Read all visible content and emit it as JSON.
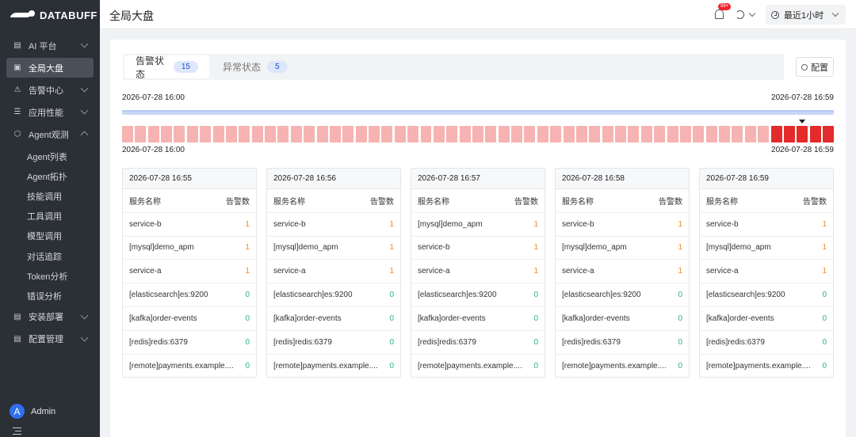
{
  "brand": {
    "name": "DATABUFF"
  },
  "sidebar": {
    "items": [
      {
        "label": "AI 平台",
        "icon": "chart-icon",
        "chevron": "down"
      },
      {
        "label": "全局大盘",
        "icon": "dashboard-icon",
        "active": true
      },
      {
        "label": "告警中心",
        "icon": "alert-icon",
        "chevron": "down"
      },
      {
        "label": "应用性能",
        "icon": "list-icon",
        "chevron": "down"
      },
      {
        "label": "Agent观测",
        "icon": "cube-icon",
        "chevron": "up"
      }
    ],
    "sub_items": [
      "Agent列表",
      "Agent拓扑",
      "技能调用",
      "工具调用",
      "模型调用",
      "对话追踪",
      "Token分析",
      "错误分析"
    ],
    "bottom_items": [
      {
        "label": "安装部署",
        "icon": "install-icon",
        "chevron": "down"
      },
      {
        "label": "配置管理",
        "icon": "settings-icon",
        "chevron": "down"
      }
    ],
    "user": {
      "initial": "A",
      "name": "Admin"
    }
  },
  "header": {
    "title": "全局大盘",
    "notification_badge": "99+",
    "time_range": "最近1小时"
  },
  "tabs": [
    {
      "label": "告警状态",
      "count": "15"
    },
    {
      "label": "异常状态",
      "count": "5"
    }
  ],
  "config_label": "配置",
  "timeline": {
    "range_start": "2026-07-28 16:00",
    "range_end": "2026-07-28 16:59",
    "blocks_start": "2026-07-28 16:00",
    "blocks_end": "2026-07-28 16:59",
    "block_count": 55,
    "severe_from_index": 50,
    "colors": {
      "normal": "#f6b3b1",
      "severe": "#e42a2a"
    }
  },
  "table_headers": {
    "service": "服务名称",
    "count": "告警数"
  },
  "tables": [
    {
      "time": "2026-07-28 16:55",
      "rows": [
        {
          "name": "service-b",
          "count": "1"
        },
        {
          "name": "[mysql]demo_apm",
          "count": "1"
        },
        {
          "name": "service-a",
          "count": "1"
        },
        {
          "name": "[elasticsearch]es:9200",
          "count": "0"
        },
        {
          "name": "[kafka]order-events",
          "count": "0"
        },
        {
          "name": "[redis]redis:6379",
          "count": "0"
        },
        {
          "name": "[remote]payments.example....",
          "count": "0"
        }
      ]
    },
    {
      "time": "2026-07-28 16:56",
      "rows": [
        {
          "name": "service-b",
          "count": "1"
        },
        {
          "name": "[mysql]demo_apm",
          "count": "1"
        },
        {
          "name": "service-a",
          "count": "1"
        },
        {
          "name": "[elasticsearch]es:9200",
          "count": "0"
        },
        {
          "name": "[kafka]order-events",
          "count": "0"
        },
        {
          "name": "[redis]redis:6379",
          "count": "0"
        },
        {
          "name": "[remote]payments.example....",
          "count": "0"
        }
      ]
    },
    {
      "time": "2026-07-28 16:57",
      "rows": [
        {
          "name": "[mysql]demo_apm",
          "count": "1"
        },
        {
          "name": "service-b",
          "count": "1"
        },
        {
          "name": "service-a",
          "count": "1"
        },
        {
          "name": "[elasticsearch]es:9200",
          "count": "0"
        },
        {
          "name": "[kafka]order-events",
          "count": "0"
        },
        {
          "name": "[redis]redis:6379",
          "count": "0"
        },
        {
          "name": "[remote]payments.example....",
          "count": "0"
        }
      ]
    },
    {
      "time": "2026-07-28 16:58",
      "rows": [
        {
          "name": "service-b",
          "count": "1"
        },
        {
          "name": "[mysql]demo_apm",
          "count": "1"
        },
        {
          "name": "service-a",
          "count": "1"
        },
        {
          "name": "[elasticsearch]es:9200",
          "count": "0"
        },
        {
          "name": "[kafka]order-events",
          "count": "0"
        },
        {
          "name": "[redis]redis:6379",
          "count": "0"
        },
        {
          "name": "[remote]payments.example....",
          "count": "0"
        }
      ]
    },
    {
      "time": "2026-07-28 16:59",
      "rows": [
        {
          "name": "service-b",
          "count": "1"
        },
        {
          "name": "[mysql]demo_apm",
          "count": "1"
        },
        {
          "name": "service-a",
          "count": "1"
        },
        {
          "name": "[elasticsearch]es:9200",
          "count": "0"
        },
        {
          "name": "[kafka]order-events",
          "count": "0"
        },
        {
          "name": "[redis]redis:6379",
          "count": "0"
        },
        {
          "name": "[remote]payments.example....",
          "count": "0"
        }
      ]
    }
  ]
}
